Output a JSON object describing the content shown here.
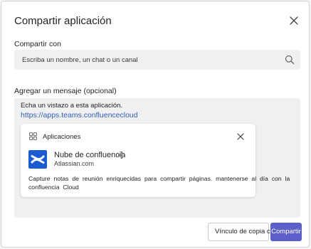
{
  "dialog": {
    "title": "Compartir aplicación",
    "share_with_label": "Compartir con",
    "search": {
      "placeholder": "Escriba un nombre, un chat o un canal",
      "value": ""
    },
    "message_label": "Agregar un mensaje (opcional)",
    "message": {
      "text": "Echa un vistazo a esta aplicación.",
      "link": "https://apps.teams.confluencecloud"
    },
    "card": {
      "header": "Aplicaciones",
      "app_name": "Nube de confluencia",
      "app_domain": "Atlassian.com",
      "description": "Capture notas de reunión enriquecidas para compartir páginas. mantenerse al día con la confluencia Cloud"
    },
    "buttons": {
      "copy_link": "Vínculo de copia co",
      "share": "Compartir"
    }
  },
  "colors": {
    "primary": "#5b5fc7",
    "link": "#2f5fb6",
    "confluence": "#1b5bd2"
  },
  "icons": [
    "close-icon",
    "search-icon",
    "apps-icon",
    "confluence-logo-icon",
    "cursor-move-icon"
  ]
}
